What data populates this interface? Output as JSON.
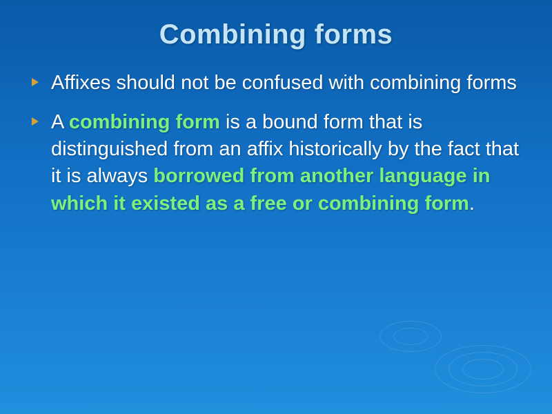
{
  "slide": {
    "title": "Combining forms",
    "bullets": [
      {
        "segments": [
          {
            "text": "Affixes should not be confused with combining forms",
            "style": "white"
          }
        ]
      },
      {
        "segments": [
          {
            "text": "A ",
            "style": "white"
          },
          {
            "text": "combining form",
            "style": "highlight"
          },
          {
            "text": " is a bound form that is distinguished from an affix historically by the fact that it is always ",
            "style": "white"
          },
          {
            "text": "borrowed from another language in which it existed as a free or combining form",
            "style": "highlight"
          },
          {
            "text": ".",
            "style": "white"
          }
        ]
      }
    ]
  }
}
